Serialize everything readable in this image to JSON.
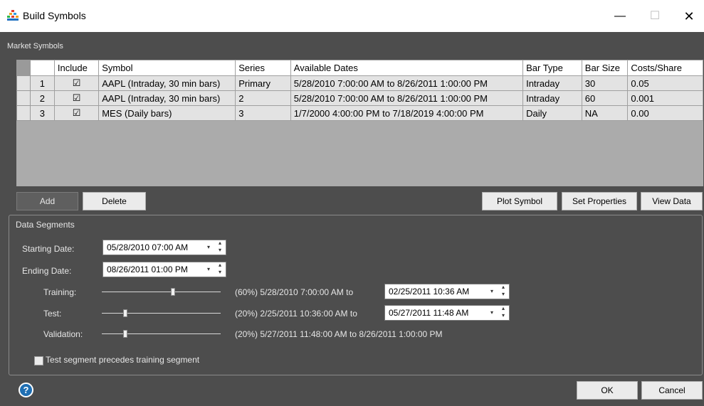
{
  "window": {
    "title": "Build Symbols",
    "minimize": "—",
    "maximize": "☐",
    "close": "✕"
  },
  "market_symbols": {
    "label": "Market Symbols",
    "columns": [
      "Include",
      "Symbol",
      "Series",
      "Available Dates",
      "Bar Type",
      "Bar Size",
      "Costs/Share"
    ],
    "rows": [
      {
        "num": "1",
        "include": "☑",
        "symbol": "AAPL (Intraday, 30 min bars)",
        "series": "Primary",
        "dates": "5/28/2010 7:00:00 AM to 8/26/2011 1:00:00 PM",
        "bar_type": "Intraday",
        "bar_size": "30",
        "costs": "0.05"
      },
      {
        "num": "2",
        "include": "☑",
        "symbol": "AAPL (Intraday, 30 min bars)",
        "series": "2",
        "dates": "5/28/2010 7:00:00 AM to 8/26/2011 1:00:00 PM",
        "bar_type": "Intraday",
        "bar_size": "60",
        "costs": "0.001"
      },
      {
        "num": "3",
        "include": "☑",
        "symbol": "MES (Daily bars)",
        "series": "3",
        "dates": "1/7/2000 4:00:00 PM to 7/18/2019 4:00:00 PM",
        "bar_type": "Daily",
        "bar_size": "NA",
        "costs": "0.00"
      }
    ]
  },
  "buttons": {
    "add": "Add",
    "delete": "Delete",
    "plot_symbol": "Plot Symbol",
    "set_properties": "Set Properties",
    "view_data": "View Data",
    "ok": "OK",
    "cancel": "Cancel"
  },
  "segments": {
    "legend": "Data Segments",
    "starting_label": "Starting Date:",
    "starting_value": "05/28/2010 07:00 AM",
    "ending_label": "Ending Date:",
    "ending_value": "08/26/2011 01:00 PM",
    "training_label": "Training:",
    "training_level": 0.6,
    "training_text": "(60%)  5/28/2010 7:00:00 AM to",
    "training_end": "02/25/2011 10:36 AM",
    "test_label": "Test:",
    "test_level": 0.2,
    "test_text": "(20%)  2/25/2011 10:36:00 AM to",
    "test_end": "05/27/2011 11:48 AM",
    "validation_label": "Validation:",
    "validation_level": 0.2,
    "validation_text": "(20%)  5/27/2011 11:48:00 AM to 8/26/2011 1:00:00 PM",
    "precedes_label": "Test segment precedes training segment"
  },
  "icons": {
    "help": "?",
    "dropdown": "▾",
    "spin": "▴▾"
  },
  "colors": {
    "background": "#4d4d4d",
    "grid_bg": "#ababab",
    "help_blue": "#1f6fb3"
  }
}
